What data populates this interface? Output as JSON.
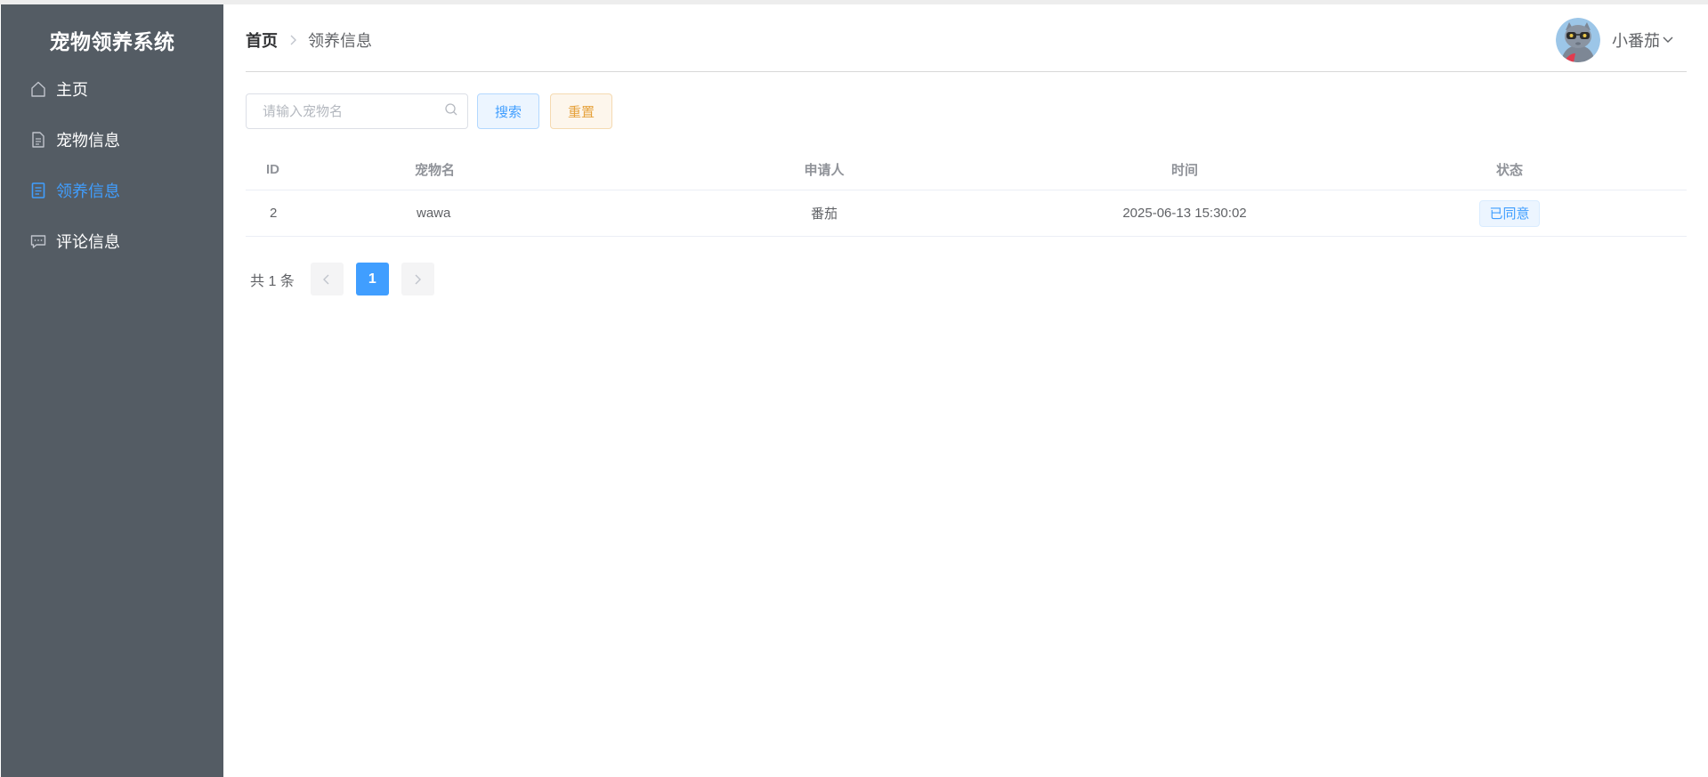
{
  "app": {
    "title": "宠物领养系统"
  },
  "sidebar": {
    "items": [
      {
        "label": "主页",
        "icon": "home-icon",
        "active": false
      },
      {
        "label": "宠物信息",
        "icon": "document-icon",
        "active": false
      },
      {
        "label": "领养信息",
        "icon": "list-document-icon",
        "active": true
      },
      {
        "label": "评论信息",
        "icon": "chat-icon",
        "active": false
      }
    ]
  },
  "header": {
    "breadcrumb": {
      "home": "首页",
      "current": "领养信息"
    },
    "user": {
      "name": "小番茄"
    }
  },
  "toolbar": {
    "search_placeholder": "请输入宠物名",
    "search_value": "",
    "search_label": "搜索",
    "reset_label": "重置"
  },
  "table": {
    "headers": {
      "id": "ID",
      "pet_name": "宠物名",
      "applicant": "申请人",
      "time": "时间",
      "status": "状态"
    },
    "rows": [
      {
        "id": "2",
        "pet_name": "wawa",
        "applicant": "番茄",
        "time": "2025-06-13 15:30:02",
        "status": "已同意"
      }
    ]
  },
  "pagination": {
    "total_text": "共 1 条",
    "current_page": "1"
  },
  "colors": {
    "sidebar_bg": "#545c64",
    "accent": "#409eff",
    "warning": "#e6a23c"
  }
}
